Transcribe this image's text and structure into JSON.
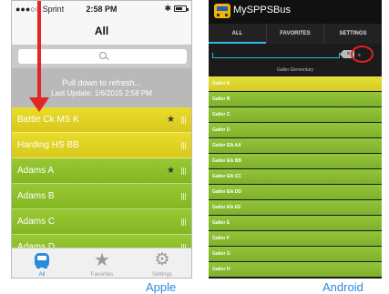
{
  "apple": {
    "caption": "Apple",
    "status": {
      "carrier": "●●●○○ Sprint",
      "time": "2:58 PM",
      "bluetooth": "✱",
      "battery_level": 0.7
    },
    "title": "All",
    "search": {
      "placeholder": ""
    },
    "refresh": {
      "line1": "Pull down to refresh...",
      "line2": "Last Update: 1/6/2015 2:58 PM"
    },
    "rows": [
      {
        "label": "Battle Ck MS K",
        "color": "yellow",
        "favorite": true
      },
      {
        "label": "Harding HS BB",
        "color": "yellow",
        "favorite": false
      },
      {
        "label": "Adams A",
        "color": "green",
        "favorite": true
      },
      {
        "label": "Adams B",
        "color": "green",
        "favorite": false
      },
      {
        "label": "Adams C",
        "color": "green",
        "favorite": false
      },
      {
        "label": "Adams D",
        "color": "green",
        "favorite": false
      }
    ],
    "tabs": [
      {
        "label": "All",
        "icon": "bus-icon",
        "active": true
      },
      {
        "label": "Favorites",
        "icon": "star-icon",
        "active": false
      },
      {
        "label": "Settings",
        "icon": "gear-icon",
        "active": false
      }
    ],
    "colors": {
      "yellow_row": "#e0d223",
      "green_row": "#8cbf2b",
      "accent": "#2a8bde",
      "arrow": "#e22525"
    }
  },
  "android": {
    "caption": "Android",
    "app_name": "MySPPSBus",
    "tabs": [
      {
        "label": "ALL",
        "active": true
      },
      {
        "label": "FAVORITES",
        "active": false
      },
      {
        "label": "SETTINGS",
        "active": false
      }
    ],
    "search": {
      "value": "",
      "clear_label": "×",
      "go_label": "≡"
    },
    "section_label": "Galter Elementary",
    "rows": [
      {
        "label": "Galter A",
        "color": "yellow"
      },
      {
        "label": "Galter B",
        "color": "green"
      },
      {
        "label": "Galter C",
        "color": "green"
      },
      {
        "label": "Galter D",
        "color": "green"
      },
      {
        "label": "Galter Elk AA",
        "color": "green"
      },
      {
        "label": "Galter Elk BB",
        "color": "green"
      },
      {
        "label": "Galter Elk CC",
        "color": "green"
      },
      {
        "label": "Galter Elk DD",
        "color": "green"
      },
      {
        "label": "Galter Elk EE",
        "color": "green"
      },
      {
        "label": "Galter E",
        "color": "green"
      },
      {
        "label": "Galter F",
        "color": "green"
      },
      {
        "label": "Galter G",
        "color": "green"
      },
      {
        "label": "Galter H",
        "color": "green"
      }
    ],
    "colors": {
      "accent": "#33b5e5",
      "highlight_circle": "#e02020"
    }
  }
}
